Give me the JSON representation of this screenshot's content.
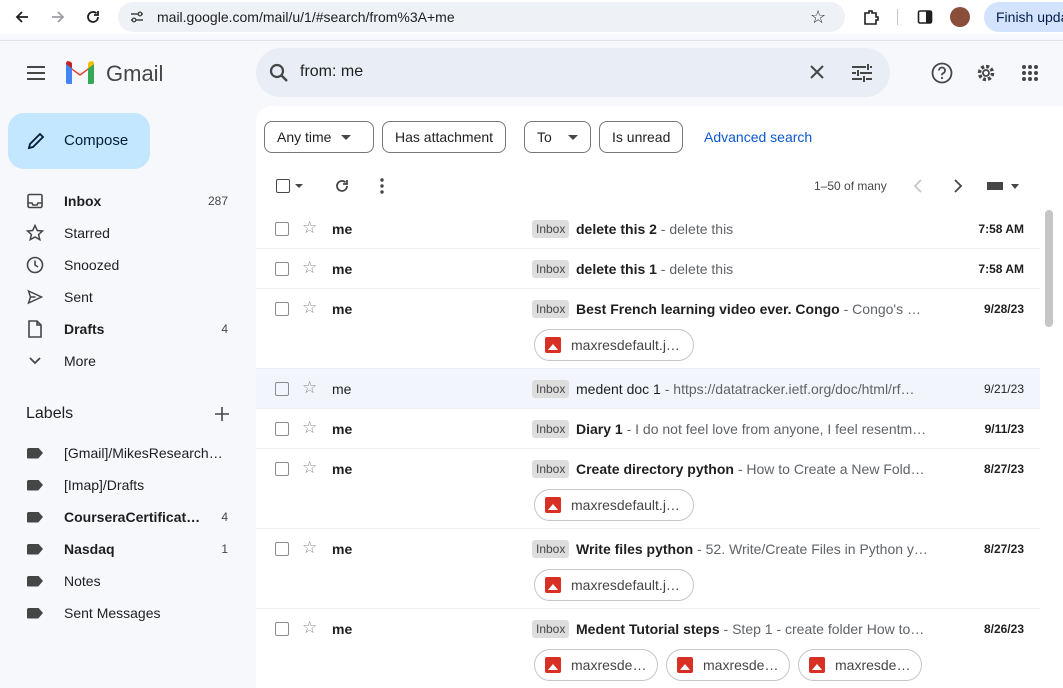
{
  "browser": {
    "url": "mail.google.com/mail/u/1/#search/from%3A+me",
    "update_button": "Finish update"
  },
  "app": {
    "name": "Gmail"
  },
  "search": {
    "query": "from: me"
  },
  "compose": {
    "label": "Compose"
  },
  "sidebar": {
    "items": [
      {
        "label": "Inbox",
        "count": "287",
        "icon": "inbox-icon",
        "bold": true
      },
      {
        "label": "Starred",
        "count": "",
        "icon": "star-icon",
        "bold": false
      },
      {
        "label": "Snoozed",
        "count": "",
        "icon": "clock-icon",
        "bold": false
      },
      {
        "label": "Sent",
        "count": "",
        "icon": "send-icon",
        "bold": false
      },
      {
        "label": "Drafts",
        "count": "4",
        "icon": "draft-icon",
        "bold": true
      },
      {
        "label": "More",
        "count": "",
        "icon": "chevron-down-icon",
        "bold": false
      }
    ],
    "labels_title": "Labels",
    "labels": [
      {
        "label": "[Gmail]/MikesResearch…",
        "count": "",
        "bold": false
      },
      {
        "label": "[Imap]/Drafts",
        "count": "",
        "bold": false
      },
      {
        "label": "CourseraCertificat…",
        "count": "4",
        "bold": true
      },
      {
        "label": "Nasdaq",
        "count": "1",
        "bold": true
      },
      {
        "label": "Notes",
        "count": "",
        "bold": false
      },
      {
        "label": "Sent Messages",
        "count": "",
        "bold": false
      }
    ]
  },
  "filters": {
    "any_time": "Any time",
    "has_attachment": "Has attachment",
    "to": "To",
    "is_unread": "Is unread",
    "advanced": "Advanced search"
  },
  "toolbar": {
    "pager": "1–50 of many"
  },
  "emails": [
    {
      "sender": "me",
      "badge": "Inbox",
      "subject": "delete this 2",
      "snippet": " - delete this",
      "date": "7:58 AM",
      "unread": true,
      "attachments": []
    },
    {
      "sender": "me",
      "badge": "Inbox",
      "subject": "delete this 1",
      "snippet": " - delete this",
      "date": "7:58 AM",
      "unread": true,
      "attachments": []
    },
    {
      "sender": "me",
      "badge": "Inbox",
      "subject": "Best French learning video ever. Congo",
      "snippet": " - Congo's …",
      "date": "9/28/23",
      "unread": true,
      "attachments": [
        "maxresdefault.j…"
      ]
    },
    {
      "sender": "me",
      "badge": "Inbox",
      "subject": "medent doc 1",
      "snippet": " - https://datatracker.ietf.org/doc/html/rf…",
      "date": "9/21/23",
      "unread": false,
      "attachments": []
    },
    {
      "sender": "me",
      "badge": "Inbox",
      "subject": "Diary 1",
      "snippet": " - I do not feel love from anyone, I feel resentm…",
      "date": "9/11/23",
      "unread": true,
      "attachments": []
    },
    {
      "sender": "me",
      "badge": "Inbox",
      "subject": "Create directory python",
      "snippet": " - How to Create a New Fold…",
      "date": "8/27/23",
      "unread": true,
      "attachments": [
        "maxresdefault.j…"
      ]
    },
    {
      "sender": "me",
      "badge": "Inbox",
      "subject": "Write files python",
      "snippet": " - 52. Write/Create Files in Python y…",
      "date": "8/27/23",
      "unread": true,
      "attachments": [
        "maxresdefault.j…"
      ]
    },
    {
      "sender": "me",
      "badge": "Inbox",
      "subject": "Medent Tutorial steps",
      "snippet": " - Step 1 - create folder How to…",
      "date": "8/26/23",
      "unread": true,
      "attachments": [
        "maxresde…",
        "maxresde…",
        "maxresde…"
      ]
    }
  ]
}
